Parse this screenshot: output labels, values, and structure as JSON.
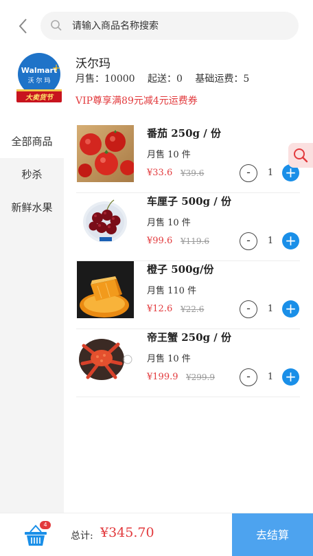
{
  "search": {
    "placeholder": "请输入商品名称搜索"
  },
  "store": {
    "name": "沃尔玛",
    "monthly_sales": "月售：10000",
    "min_order": "起送：0",
    "base_fee": "基础运费：5",
    "vip_offer": "VIP尊享满89元减4元运费券",
    "logo": {
      "brand": "Walmart",
      "brand_cn": "沃尔玛",
      "tag": "大卖货节"
    }
  },
  "sidebar": {
    "items": [
      {
        "label": "全部商品"
      },
      {
        "label": "秒杀"
      },
      {
        "label": "新鲜水果"
      }
    ]
  },
  "products": [
    {
      "name": "番茄 250g / 份",
      "sold": "月售 10 件",
      "price": "¥33.6",
      "original_price": "¥39.6",
      "qty": "1",
      "minus": "-",
      "plus": "+"
    },
    {
      "name": "车厘子 500g / 份",
      "sold": "月售 10 件",
      "price": "¥99.6",
      "original_price": "¥119.6",
      "qty": "1",
      "minus": "-",
      "plus": "+"
    },
    {
      "name": "橙子 500g/份",
      "sold": "月售 110 件",
      "price": "¥12.6",
      "original_price": "¥22.6",
      "qty": "1",
      "minus": "-",
      "plus": "+"
    },
    {
      "name": "帝王蟹 250g / 份",
      "sold": "月售 10 件",
      "price": "¥199.9",
      "original_price": "¥299.9",
      "qty": "1",
      "minus": "-",
      "plus": "+"
    }
  ],
  "cart": {
    "badge": "4",
    "total_label": "总计:",
    "total_value": "¥345.70",
    "checkout_label": "去结算"
  },
  "colors": {
    "accent_blue": "#1a8fe8",
    "checkout_blue": "#4da3ef",
    "price_red": "#e2393c",
    "sidebar_bg": "#f4f4f4"
  },
  "icons": {
    "back": "chevron-left-icon",
    "search": "search-icon",
    "cart": "basket-icon",
    "float_search": "search-icon"
  }
}
